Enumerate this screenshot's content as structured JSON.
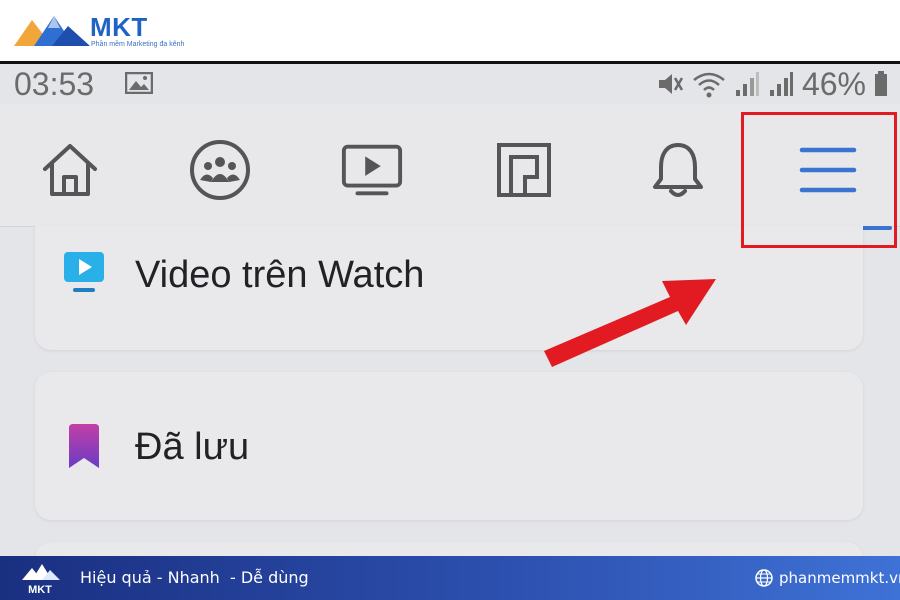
{
  "brand": {
    "name": "MKT",
    "tagline": "Phần mềm Marketing đa kênh",
    "colors": {
      "primary": "#1f63c6",
      "secondary": "#f2a63a"
    }
  },
  "status_bar": {
    "time": "03:53",
    "battery": "46%",
    "icons": [
      "image-icon",
      "mute-icon",
      "wifi-icon",
      "signal-icon",
      "signal-icon",
      "battery-icon"
    ]
  },
  "nav": {
    "items": [
      {
        "icon": "home-icon"
      },
      {
        "icon": "groups-icon"
      },
      {
        "icon": "watch-video-icon"
      },
      {
        "icon": "marketplace-icon"
      },
      {
        "icon": "bell-icon"
      },
      {
        "icon": "menu-icon",
        "active": true
      }
    ],
    "active_color": "#3a73d0",
    "highlight_color": "#e21b23"
  },
  "menu_cards": [
    {
      "icon": "video-watch-icon",
      "label": "Video trên Watch"
    },
    {
      "icon": "saved-bookmark-icon",
      "label": "Đã lưu"
    }
  ],
  "footer": {
    "brand": "MKT",
    "slogan": "Hiệu quả - Nhanh  - Dễ dùng",
    "website": "phanmemmkt.vn"
  }
}
